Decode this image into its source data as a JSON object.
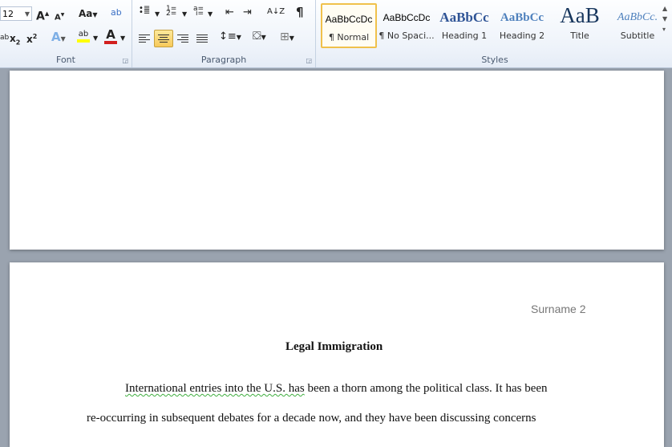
{
  "ribbon": {
    "font": {
      "label": "Font",
      "size_value": "12",
      "grow_label": "A",
      "shrink_label": "A",
      "change_case_label": "Aa",
      "subscript_label": "x",
      "superscript_label": "x",
      "font_color_label": "A"
    },
    "paragraph": {
      "label": "Paragraph",
      "sort_label": "A↓Z",
      "show_marks_label": "¶"
    },
    "styles": {
      "label": "Styles",
      "items": [
        {
          "sample": "AaBbCcDc",
          "name": "¶ Normal"
        },
        {
          "sample": "AaBbCcDc",
          "name": "¶ No Spaci..."
        },
        {
          "sample": "AaBbCc",
          "name": "Heading 1"
        },
        {
          "sample": "AaBbCc",
          "name": "Heading 2"
        },
        {
          "sample": "AaB",
          "name": "Title"
        },
        {
          "sample": "AaBbCc.",
          "name": "Subtitle"
        }
      ]
    }
  },
  "document": {
    "header_text": "Surname 2",
    "title": "Legal Immigration",
    "line1_err": "International entries into the U.S. has",
    "line1_rest": " been a thorn among the political class.  It has been",
    "line2": "re-occurring in subsequent debates for a decade now, and they have been discussing concerns"
  }
}
